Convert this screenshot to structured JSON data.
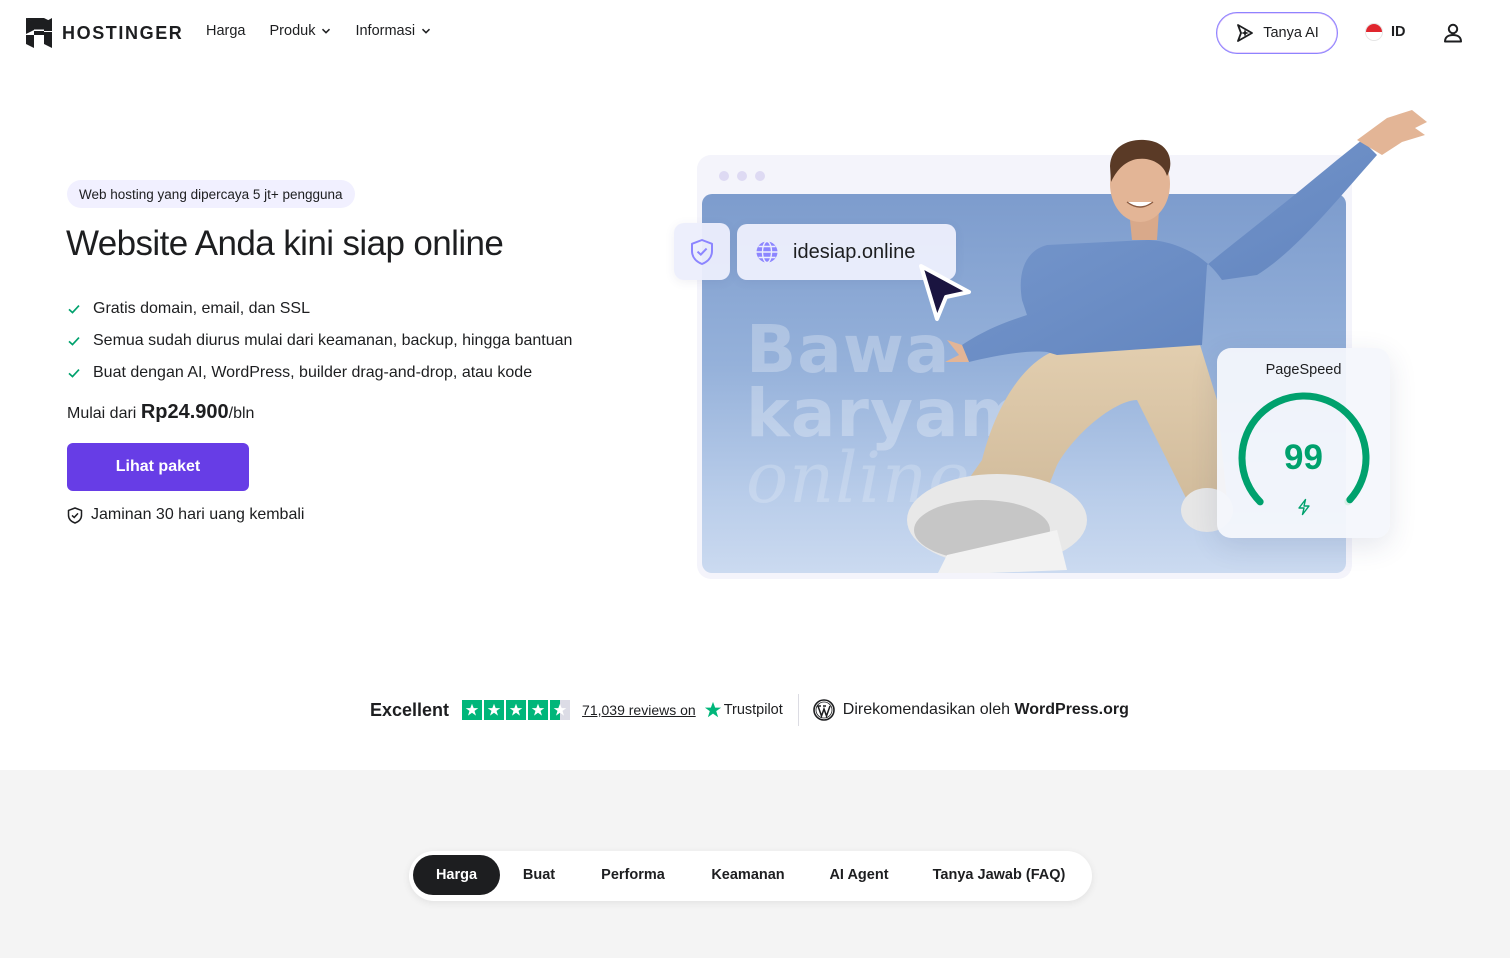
{
  "nav": {
    "brand": "HOSTINGER",
    "links": [
      {
        "label": "Harga",
        "has_dropdown": false
      },
      {
        "label": "Produk",
        "has_dropdown": true
      },
      {
        "label": "Informasi",
        "has_dropdown": true
      }
    ],
    "ask_ai_label": "Tanya AI",
    "language": "ID"
  },
  "hero": {
    "badge": "Web hosting yang dipercaya 5 jt+ pengguna",
    "title": "Website Anda kini siap online",
    "features": [
      "Gratis domain, email, dan SSL",
      "Semua sudah diurus mulai dari keamanan, backup, hingga bantuan",
      "Buat dengan AI, WordPress, builder drag-and-drop, atau kode"
    ],
    "price_prefix": "Mulai dari ",
    "price_amount": "Rp24.900",
    "price_suffix": "/bln",
    "cta_label": "Lihat paket",
    "guarantee": "Jaminan 30 hari uang kembali"
  },
  "illustration": {
    "domain": "idesiap.online",
    "watermark_lines": [
      "Bawa",
      "karyamu",
      "online"
    ],
    "pagespeed_label": "PageSpeed",
    "pagespeed_score": "99",
    "pagespeed_fraction": 0.99
  },
  "trust": {
    "rating_label": "Excellent",
    "stars": 4.5,
    "reviews_text": "71,039 reviews on",
    "trustpilot": "Trustpilot",
    "wp_prefix": "Direkomendasikan oleh ",
    "wp_name": "WordPress.org"
  },
  "section_tabs": [
    "Harga",
    "Buat",
    "Performa",
    "Keamanan",
    "AI Agent",
    "Tanya Jawab (FAQ)"
  ],
  "section_tabs_active": 0,
  "colors": {
    "accent": "#673de6",
    "success": "#00a16d",
    "trustpilot": "#00b67a",
    "text": "#1d1e20"
  }
}
